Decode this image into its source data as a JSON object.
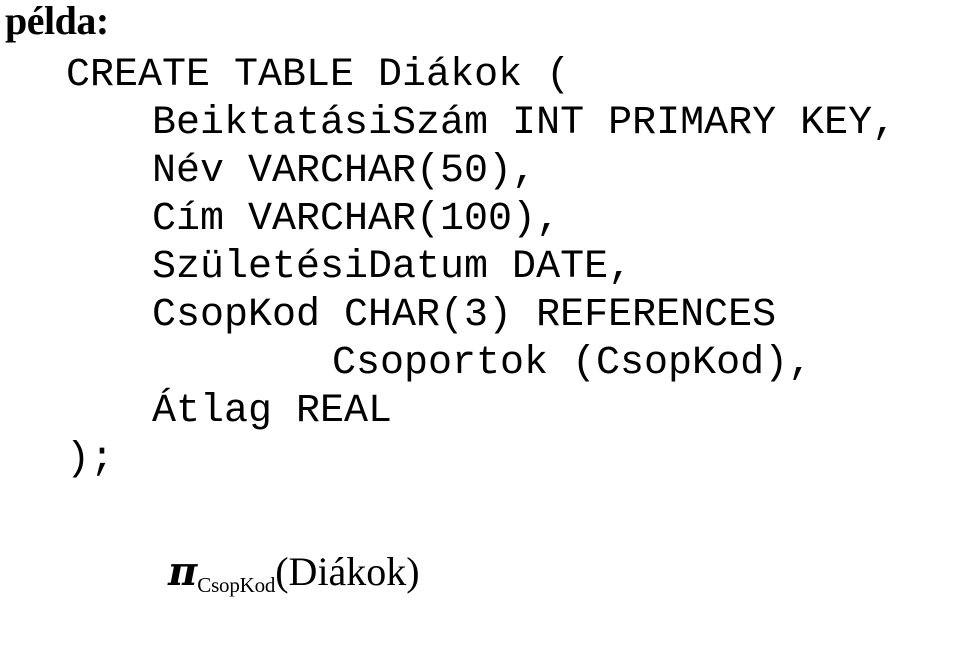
{
  "slide": {
    "background_color": "#ffffff",
    "text_color": "#000000",
    "heading": "példa:"
  },
  "sql": {
    "language": "SQL",
    "statement_lines": [
      "CREATE TABLE Diákok (",
      "BeiktatásiSzám INT PRIMARY KEY,",
      "Név VARCHAR(50),",
      "Cím VARCHAR(100),",
      "SzületésiDatum DATE,",
      "CsopKod CHAR(3) REFERENCES",
      "Csoportok (CsopKod),",
      "Átlag REAL",
      ");"
    ],
    "table_name": "Diákok",
    "columns": [
      {
        "name": "BeiktatásiSzám",
        "type": "INT",
        "constraint": "PRIMARY KEY"
      },
      {
        "name": "Név",
        "type": "VARCHAR(50)",
        "constraint": ""
      },
      {
        "name": "Cím",
        "type": "VARCHAR(100)",
        "constraint": ""
      },
      {
        "name": "SzületésiDatum",
        "type": "DATE",
        "constraint": ""
      },
      {
        "name": "CsopKod",
        "type": "CHAR(3)",
        "constraint": "REFERENCES Csoportok (CsopKod)"
      },
      {
        "name": "Átlag",
        "type": "REAL",
        "constraint": ""
      }
    ]
  },
  "relational_algebra": {
    "operator_symbol": "π",
    "subscript": "CsopKod",
    "operand": "(Diákok)",
    "full_text": "πCsopKod(Diákok)"
  }
}
